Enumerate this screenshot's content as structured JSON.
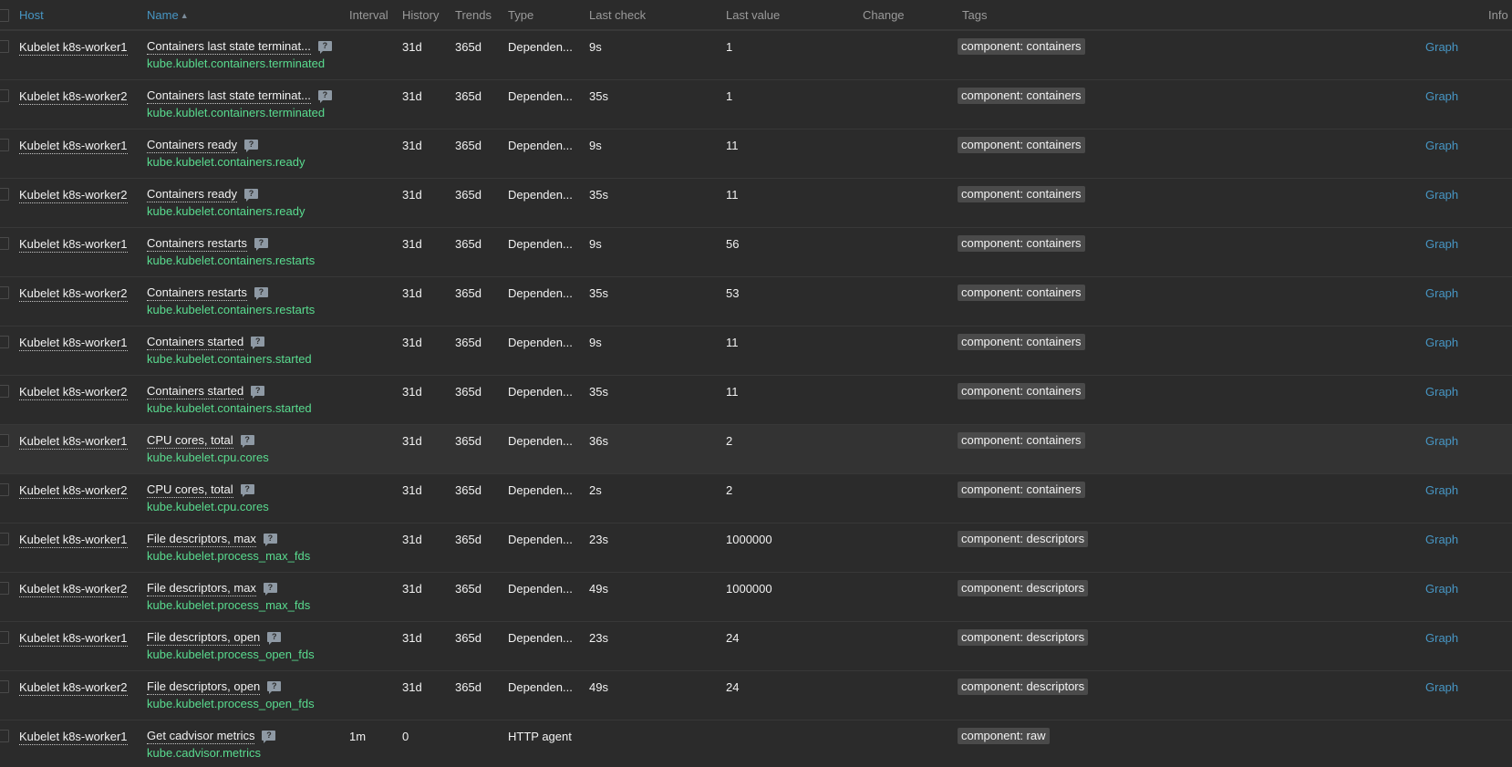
{
  "columns": {
    "host": "Host",
    "name": "Name",
    "name_sort_indicator": "▲",
    "interval": "Interval",
    "history": "History",
    "trends": "Trends",
    "type": "Type",
    "last_check": "Last check",
    "last_value": "Last value",
    "change": "Change",
    "tags": "Tags",
    "info": "Info"
  },
  "help_icon_glyph": "?",
  "rows": [
    {
      "host": "Kubelet k8s-worker1",
      "name": "Containers last state terminat...",
      "key": "kube.kublet.containers.terminated",
      "interval": "",
      "history": "31d",
      "trends": "365d",
      "type": "Dependen...",
      "last_check": "9s",
      "last_value": "1",
      "change": "",
      "tag": "component: containers",
      "action": "Graph"
    },
    {
      "host": "Kubelet k8s-worker2",
      "name": "Containers last state terminat...",
      "key": "kube.kublet.containers.terminated",
      "interval": "",
      "history": "31d",
      "trends": "365d",
      "type": "Dependen...",
      "last_check": "35s",
      "last_value": "1",
      "change": "",
      "tag": "component: containers",
      "action": "Graph"
    },
    {
      "host": "Kubelet k8s-worker1",
      "name": "Containers ready",
      "key": "kube.kubelet.containers.ready",
      "interval": "",
      "history": "31d",
      "trends": "365d",
      "type": "Dependen...",
      "last_check": "9s",
      "last_value": "11",
      "change": "",
      "tag": "component: containers",
      "action": "Graph"
    },
    {
      "host": "Kubelet k8s-worker2",
      "name": "Containers ready",
      "key": "kube.kubelet.containers.ready",
      "interval": "",
      "history": "31d",
      "trends": "365d",
      "type": "Dependen...",
      "last_check": "35s",
      "last_value": "11",
      "change": "",
      "tag": "component: containers",
      "action": "Graph"
    },
    {
      "host": "Kubelet k8s-worker1",
      "name": "Containers restarts",
      "key": "kube.kubelet.containers.restarts",
      "interval": "",
      "history": "31d",
      "trends": "365d",
      "type": "Dependen...",
      "last_check": "9s",
      "last_value": "56",
      "change": "",
      "tag": "component: containers",
      "action": "Graph"
    },
    {
      "host": "Kubelet k8s-worker2",
      "name": "Containers restarts",
      "key": "kube.kubelet.containers.restarts",
      "interval": "",
      "history": "31d",
      "trends": "365d",
      "type": "Dependen...",
      "last_check": "35s",
      "last_value": "53",
      "change": "",
      "tag": "component: containers",
      "action": "Graph"
    },
    {
      "host": "Kubelet k8s-worker1",
      "name": "Containers started",
      "key": "kube.kubelet.containers.started",
      "interval": "",
      "history": "31d",
      "trends": "365d",
      "type": "Dependen...",
      "last_check": "9s",
      "last_value": "11",
      "change": "",
      "tag": "component: containers",
      "action": "Graph"
    },
    {
      "host": "Kubelet k8s-worker2",
      "name": "Containers started",
      "key": "kube.kubelet.containers.started",
      "interval": "",
      "history": "31d",
      "trends": "365d",
      "type": "Dependen...",
      "last_check": "35s",
      "last_value": "11",
      "change": "",
      "tag": "component: containers",
      "action": "Graph"
    },
    {
      "host": "Kubelet k8s-worker1",
      "name": "CPU cores, total",
      "key": "kube.kubelet.cpu.cores",
      "interval": "",
      "history": "31d",
      "trends": "365d",
      "type": "Dependen...",
      "last_check": "36s",
      "last_value": "2",
      "change": "",
      "tag": "component: containers",
      "action": "Graph",
      "highlighted": true
    },
    {
      "host": "Kubelet k8s-worker2",
      "name": "CPU cores, total",
      "key": "kube.kubelet.cpu.cores",
      "interval": "",
      "history": "31d",
      "trends": "365d",
      "type": "Dependen...",
      "last_check": "2s",
      "last_value": "2",
      "change": "",
      "tag": "component: containers",
      "action": "Graph"
    },
    {
      "host": "Kubelet k8s-worker1",
      "name": "File descriptors, max",
      "key": "kube.kubelet.process_max_fds",
      "interval": "",
      "history": "31d",
      "trends": "365d",
      "type": "Dependen...",
      "last_check": "23s",
      "last_value": "1000000",
      "change": "",
      "tag": "component: descriptors",
      "action": "Graph"
    },
    {
      "host": "Kubelet k8s-worker2",
      "name": "File descriptors, max",
      "key": "kube.kubelet.process_max_fds",
      "interval": "",
      "history": "31d",
      "trends": "365d",
      "type": "Dependen...",
      "last_check": "49s",
      "last_value": "1000000",
      "change": "",
      "tag": "component: descriptors",
      "action": "Graph"
    },
    {
      "host": "Kubelet k8s-worker1",
      "name": "File descriptors, open",
      "key": "kube.kubelet.process_open_fds",
      "interval": "",
      "history": "31d",
      "trends": "365d",
      "type": "Dependen...",
      "last_check": "23s",
      "last_value": "24",
      "change": "",
      "tag": "component: descriptors",
      "action": "Graph"
    },
    {
      "host": "Kubelet k8s-worker2",
      "name": "File descriptors, open",
      "key": "kube.kubelet.process_open_fds",
      "interval": "",
      "history": "31d",
      "trends": "365d",
      "type": "Dependen...",
      "last_check": "49s",
      "last_value": "24",
      "change": "",
      "tag": "component: descriptors",
      "action": "Graph"
    },
    {
      "host": "Kubelet k8s-worker1",
      "name": "Get cadvisor metrics",
      "key": "kube.cadvisor.metrics",
      "interval": "1m",
      "history": "0",
      "trends": "",
      "type": "HTTP agent",
      "last_check": "",
      "last_value": "",
      "change": "",
      "tag": "component: raw",
      "action": ""
    }
  ]
}
